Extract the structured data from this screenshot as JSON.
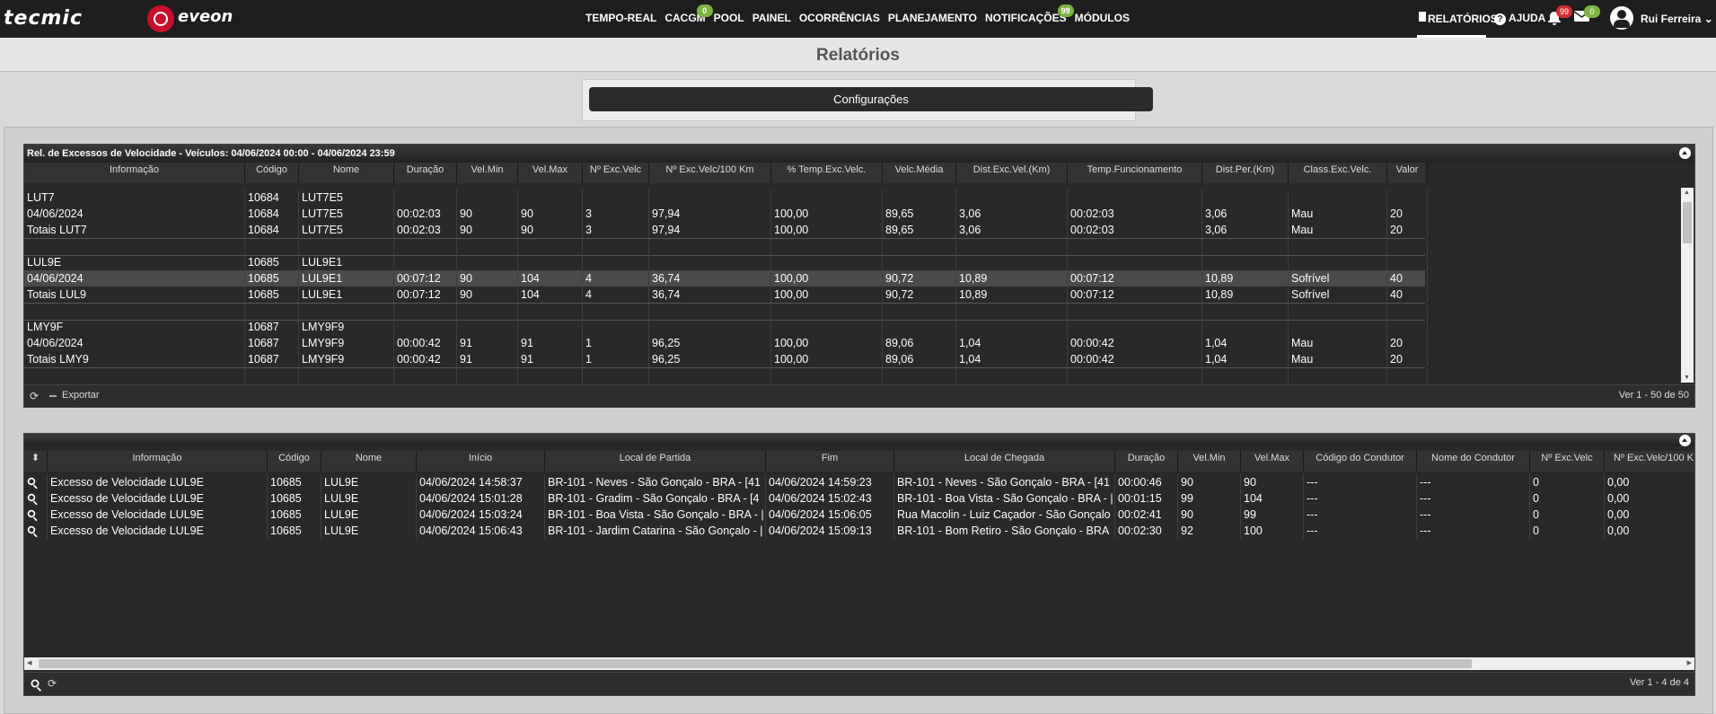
{
  "brand": {
    "logo1": "tecmic",
    "logo2": "eveon"
  },
  "nav": {
    "items": [
      {
        "label": "TEMPO-REAL"
      },
      {
        "label": "CACGM",
        "badge": "0"
      },
      {
        "label": "POOL"
      },
      {
        "label": "PAINEL"
      },
      {
        "label": "OCORRÊNCIAS"
      },
      {
        "label": "PLANEJAMENTO"
      },
      {
        "label": "NOTIFICAÇÕES",
        "badge": "99"
      },
      {
        "label": "MÓDULOS"
      }
    ]
  },
  "topright": {
    "relatorios": "RELATÓRIOS",
    "ajuda": "AJUDA",
    "ajuda_icon": "?",
    "bell_badge": "99",
    "mail_badge": "0",
    "user": "Rui Ferreira"
  },
  "page": {
    "title": "Relatórios",
    "config_button": "Configurações"
  },
  "grid1": {
    "caption": "Rel. de Excessos de Velocidade - Veículos: 04/06/2024 00:00 - 04/06/2024 23:59",
    "columns": [
      "Informação",
      "Código",
      "Nome",
      "Duração",
      "Vel.Min",
      "Vel.Max",
      "Nº Exc.Velc",
      "Nº Exc.Velc/100 Km",
      "% Temp.Exc.Velc.",
      "Velc.Média",
      "Dist.Exc.Vel.(Km)",
      "Temp.Funcionamento",
      "Dist.Per.(Km)",
      "Class.Exc.Velc.",
      "Valor"
    ],
    "rows": [
      [
        "LUT7",
        "10684",
        "LUT7E5",
        "",
        "",
        "",
        "",
        "",
        "",
        "",
        "",
        "",
        "",
        "",
        ""
      ],
      [
        "04/06/2024",
        "10684",
        "LUT7E5",
        "00:02:03",
        "90",
        "90",
        "3",
        "97,94",
        "100,00",
        "89,65",
        "3,06",
        "00:02:03",
        "3,06",
        "Mau",
        "20"
      ],
      [
        "Totais LUT7",
        "10684",
        "LUT7E5",
        "00:02:03",
        "90",
        "90",
        "3",
        "97,94",
        "100,00",
        "89,65",
        "3,06",
        "00:02:03",
        "3,06",
        "Mau",
        "20"
      ],
      [
        "",
        "",
        "",
        "",
        "",
        "",
        "",
        "",
        "",
        "",
        "",
        "",
        "",
        "",
        ""
      ],
      [
        "LUL9E",
        "10685",
        "LUL9E1",
        "",
        "",
        "",
        "",
        "",
        "",
        "",
        "",
        "",
        "",
        "",
        ""
      ],
      [
        "04/06/2024",
        "10685",
        "LUL9E1",
        "00:07:12",
        "90",
        "104",
        "4",
        "36,74",
        "100,00",
        "90,72",
        "10,89",
        "00:07:12",
        "10,89",
        "Sofrível",
        "40"
      ],
      [
        "Totais LUL9",
        "10685",
        "LUL9E1",
        "00:07:12",
        "90",
        "104",
        "4",
        "36,74",
        "100,00",
        "90,72",
        "10,89",
        "00:07:12",
        "10,89",
        "Sofrível",
        "40"
      ],
      [
        "",
        "",
        "",
        "",
        "",
        "",
        "",
        "",
        "",
        "",
        "",
        "",
        "",
        "",
        ""
      ],
      [
        "LMY9F",
        "10687",
        "LMY9F9",
        "",
        "",
        "",
        "",
        "",
        "",
        "",
        "",
        "",
        "",
        "",
        ""
      ],
      [
        "04/06/2024",
        "10687",
        "LMY9F9",
        "00:00:42",
        "91",
        "91",
        "1",
        "96,25",
        "100,00",
        "89,06",
        "1,04",
        "00:00:42",
        "1,04",
        "Mau",
        "20"
      ],
      [
        "Totais LMY9",
        "10687",
        "LMY9F9",
        "00:00:42",
        "91",
        "91",
        "1",
        "96,25",
        "100,00",
        "89,06",
        "1,04",
        "00:00:42",
        "1,04",
        "Mau",
        "20"
      ],
      [
        "",
        "",
        "",
        "",
        "",
        "",
        "",
        "",
        "",
        "",
        "",
        "",
        "",
        "",
        ""
      ]
    ],
    "footer": {
      "export": "Exportar",
      "pager": "Ver 1 - 50 de 50"
    }
  },
  "grid2": {
    "columns": [
      "Informação",
      "Código",
      "Nome",
      "Início",
      "Local de Partida",
      "Fim",
      "Local de Chegada",
      "Duração",
      "Vel.Min",
      "Vel.Max",
      "Código do Condutor",
      "Nome do Condutor",
      "Nº Exc.Velc",
      "Nº Exc.Velc/100 K"
    ],
    "rows": [
      [
        "Excesso de Velocidade LUL9E",
        "10685",
        "LUL9E",
        "04/06/2024 14:58:37",
        "BR-101 - Neves - São Gonçalo - BRA - [41",
        "04/06/2024 14:59:23",
        "BR-101 - Neves - São Gonçalo - BRA - [41",
        "00:00:46",
        "90",
        "90",
        "---",
        "---",
        "0",
        "0,00"
      ],
      [
        "Excesso de Velocidade LUL9E",
        "10685",
        "LUL9E",
        "04/06/2024 15:01:28",
        "BR-101 - Gradim - São Gonçalo - BRA - [4",
        "04/06/2024 15:02:43",
        "BR-101 - Boa Vista - São Gonçalo - BRA - |",
        "00:01:15",
        "99",
        "104",
        "---",
        "---",
        "0",
        "0,00"
      ],
      [
        "Excesso de Velocidade LUL9E",
        "10685",
        "LUL9E",
        "04/06/2024 15:03:24",
        "BR-101 - Boa Vista - São Gonçalo - BRA - |",
        "04/06/2024 15:06:05",
        "Rua Macolin - Luiz Caçador - São Gonçalo",
        "00:02:41",
        "90",
        "99",
        "---",
        "---",
        "0",
        "0,00"
      ],
      [
        "Excesso de Velocidade LUL9E",
        "10685",
        "LUL9E",
        "04/06/2024 15:06:43",
        "BR-101 - Jardim Catarina - São Gonçalo - |",
        "04/06/2024 15:09:13",
        "BR-101 - Bom Retiro - São Gonçalo - BRA",
        "00:02:30",
        "92",
        "100",
        "---",
        "---",
        "0",
        "0,00"
      ]
    ],
    "footer": {
      "pager": "Ver 1 - 4 de 4"
    }
  }
}
